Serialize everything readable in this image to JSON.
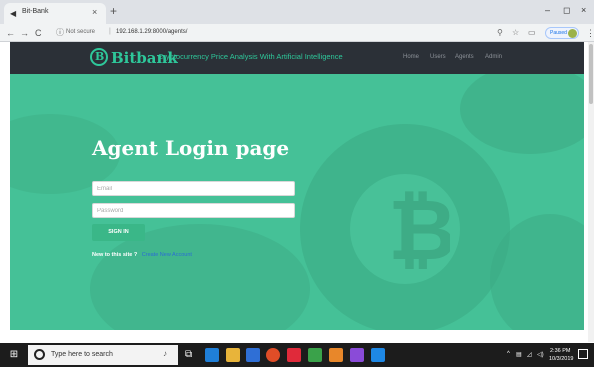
{
  "browser": {
    "tab_title": "Bit-Bank",
    "tab_close": "×",
    "new_tab": "+",
    "back": "←",
    "forward": "→",
    "reload": "C",
    "secure_icon": "ⓘ",
    "secure_label": "Not secure",
    "separator": "|",
    "url": "192.168.1.29:8000/agents/",
    "paused_label": "Paused",
    "minimize": "–",
    "maximize": "◻",
    "close": "×",
    "menu": "⋮"
  },
  "site": {
    "brand": "Bitbank",
    "logo_glyph": "B",
    "tagline": "Cryptocurrency Price Analysis With Artificial Intelligence",
    "nav": [
      "Home",
      "Users",
      "Agents",
      "Admin"
    ]
  },
  "login": {
    "heading": "Agent Login page",
    "email_placeholder": "Email",
    "password_placeholder": "Password",
    "signin_label": "SIGN IN",
    "new_prompt": "New to this site ?",
    "create_link": "Create New Account"
  },
  "taskbar": {
    "search_placeholder": "Type here to search",
    "time": "2:36 PM",
    "date": "10/3/2019"
  },
  "colors": {
    "accent": "#2ec79a",
    "hero": "#45c197",
    "nav_bg": "#2b3037",
    "link": "#2b6cd4"
  }
}
